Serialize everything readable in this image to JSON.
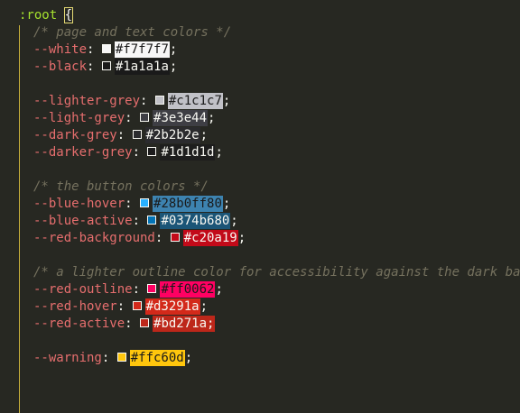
{
  "code": {
    "selector": ":root",
    "open_brace": "{",
    "comments": {
      "page_text": "/* page and text colors */",
      "button": "/* the button colors */",
      "outline": "/* a lighter outline color for accessibility against the dark ba"
    },
    "vars": [
      {
        "name": "--white",
        "value": "#f7f7f7",
        "swatch": "#f7f7f7",
        "hl_bg": "#f7f7f7",
        "hl_fg": "#1a1a1a",
        "end": ";"
      },
      {
        "name": "--black",
        "value": "#1a1a1a",
        "swatch": "#1a1a1a",
        "hl_bg": "#1a1a1a",
        "hl_fg": "#f8f8f2",
        "end": ";"
      },
      {
        "name": "--lighter-grey",
        "value": "#c1c1c7",
        "swatch": "#c1c1c7",
        "hl_bg": "#c1c1c7",
        "hl_fg": "#1a1a1a",
        "end": ";"
      },
      {
        "name": "--light-grey",
        "value": "#3e3e44",
        "swatch": "#3e3e44",
        "hl_bg": "#3e3e44",
        "hl_fg": "#f8f8f2",
        "end": ";"
      },
      {
        "name": "--dark-grey",
        "value": "#2b2b2e",
        "swatch": "#2b2b2e",
        "hl_bg": "#2b2b2e",
        "hl_fg": "#f8f8f2",
        "end": ";"
      },
      {
        "name": "--darker-grey",
        "value": "#1d1d1d",
        "swatch": "#1d1d1d",
        "hl_bg": "#1d1d1d",
        "hl_fg": "#f8f8f2",
        "end": ";"
      },
      {
        "name": "--blue-hover",
        "value": "#28b0ff80",
        "swatch": "#28b0ff",
        "hl_bg": "#3d83b0",
        "hl_fg": "#1a1a1a",
        "end": ";"
      },
      {
        "name": "--blue-active",
        "value": "#0374b680",
        "swatch": "#0374b6",
        "hl_bg": "#1b5577",
        "hl_fg": "#f8f8f2",
        "end": ";"
      },
      {
        "name": "--red-background",
        "value": "#c20a19",
        "swatch": "#c20a19",
        "hl_bg": "#c20a19",
        "hl_fg": "#f8f8f2",
        "end": ";"
      },
      {
        "name": "--red-outline",
        "value": "#ff0062",
        "swatch": "#ff0062",
        "hl_bg": "#ff0062",
        "hl_fg": "#1a1a1a",
        "end": ";"
      },
      {
        "name": "--red-hover",
        "value": "#d3291a",
        "swatch": "#d3291a",
        "hl_bg": "#d3291a",
        "hl_fg": "#f8f8f2",
        "end": ";"
      },
      {
        "name": "--red-active",
        "value": "#bd271a;",
        "swatch": "#bd271a",
        "hl_bg": "#bd271a",
        "hl_fg": "#f8f8f2",
        "end": ""
      },
      {
        "name": "--warning",
        "value": "#ffc60d",
        "swatch": "#ffc60d",
        "hl_bg": "#ffc60d",
        "hl_fg": "#1a1a1a",
        "end": ";"
      }
    ]
  }
}
